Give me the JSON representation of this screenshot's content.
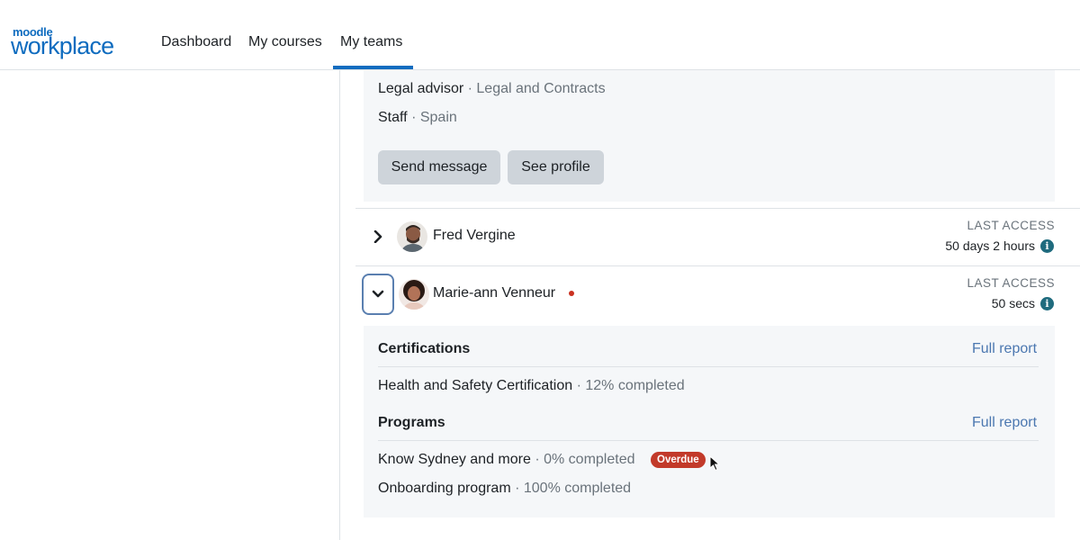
{
  "brand": {
    "logo_top": "moodle",
    "logo_bottom": "workplace"
  },
  "nav": {
    "items": [
      {
        "label": "Dashboard"
      },
      {
        "label": "My courses"
      },
      {
        "label": "My teams",
        "active": true
      }
    ]
  },
  "previous_user": {
    "position_title": "Legal advisor",
    "position_dept": "Legal and Contracts",
    "role": "Staff",
    "location": "Spain",
    "send_message_label": "Send message",
    "see_profile_label": "See profile"
  },
  "users": [
    {
      "name": "Fred Vergine",
      "last_access_label": "LAST ACCESS",
      "last_access_value": "50 days 2 hours",
      "expanded": false
    },
    {
      "name": "Marie-ann Venneur",
      "last_access_label": "LAST ACCESS",
      "last_access_value": "50 secs",
      "online": true,
      "expanded": true
    }
  ],
  "expanded_details": {
    "certifications": {
      "heading": "Certifications",
      "full_report_label": "Full report",
      "items": [
        {
          "name": "Health and Safety Certification",
          "progress": "12% completed"
        }
      ]
    },
    "programs": {
      "heading": "Programs",
      "full_report_label": "Full report",
      "items": [
        {
          "name": "Know Sydney and more",
          "progress": "0% completed",
          "badge": "Overdue"
        },
        {
          "name": "Onboarding program",
          "progress": "100% completed"
        }
      ]
    }
  },
  "separator": "·",
  "colors": {
    "accent": "#0f6cbf",
    "link": "#4b77b0",
    "badge": "#c23a2a",
    "online": "#ca3120",
    "info": "#1f6b7e"
  },
  "icons": {
    "expand": "chevron-right-icon",
    "collapse": "chevron-down-icon",
    "info": "info-icon",
    "cursor": "mouse-pointer-icon"
  }
}
